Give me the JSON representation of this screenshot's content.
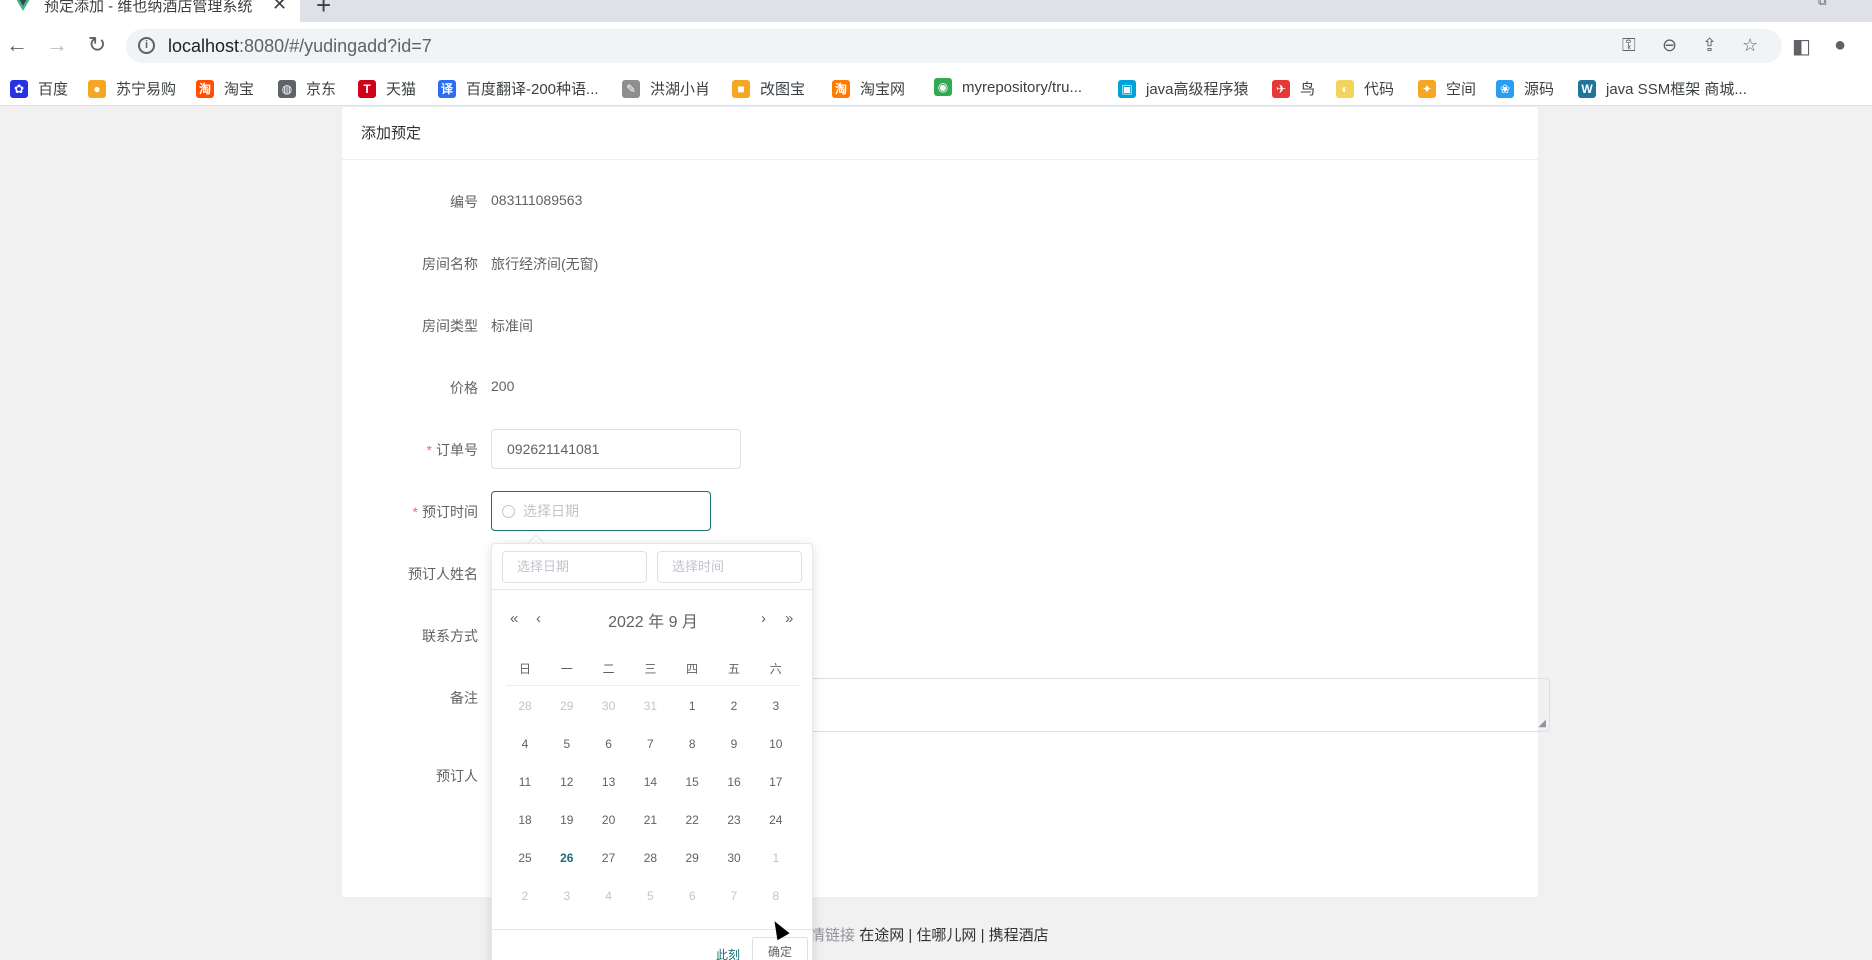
{
  "browser": {
    "tab_title": "预定添加 - 维也纳酒店管理系统",
    "tab_close": "✕",
    "new_tab": "+",
    "url_host": "localhost",
    "url_rest": ":8080/#/yudingadd?id=7"
  },
  "bookmarks": [
    {
      "label": "百度",
      "color": "#2932e1",
      "glyph": "✿"
    },
    {
      "label": "苏宁易购",
      "color": "#f5a623",
      "glyph": "●"
    },
    {
      "label": "淘宝",
      "color": "#ff5000",
      "glyph": "淘"
    },
    {
      "label": "京东",
      "color": "#5f6368",
      "glyph": "◍"
    },
    {
      "label": "天猫",
      "color": "#d0021b",
      "glyph": "T"
    },
    {
      "label": "百度翻译-200种语...",
      "color": "#2a6ef5",
      "glyph": "译"
    },
    {
      "label": "洪湖小肖",
      "color": "#8e8e8e",
      "glyph": "✎"
    },
    {
      "label": "改图宝",
      "color": "#f5a623",
      "glyph": "■"
    },
    {
      "label": "淘宝网",
      "color": "#ff7a00",
      "glyph": "淘"
    },
    {
      "label": "myrepository/tru...",
      "color": "#34a853",
      "glyph": "◉"
    },
    {
      "label": "java高级程序猿",
      "color": "#00a1d6",
      "glyph": "▣"
    },
    {
      "label": "鸟",
      "color": "#e53935",
      "glyph": "✈"
    },
    {
      "label": "代码",
      "color": "#f2d45c",
      "glyph": "◐"
    },
    {
      "label": "空间",
      "color": "#f5a623",
      "glyph": "✦"
    },
    {
      "label": "源码",
      "color": "#2a9df4",
      "glyph": "❀"
    },
    {
      "label": "java SSM框架 商城...",
      "color": "#21759b",
      "glyph": "W"
    }
  ],
  "card_title": "添加预定",
  "form": {
    "bianhao_label": "编号",
    "bianhao_value": "083111089563",
    "fangjianmingcheng_label": "房间名称",
    "fangjianmingcheng_value": "旅行经济间(无窗)",
    "fangjianleixing_label": "房间类型",
    "fangjianleixing_value": "标准间",
    "jiage_label": "价格",
    "jiage_value": "200",
    "dingdanhao_label": "订单号",
    "dingdanhao_value": "092621141081",
    "yudingshijian_label": "预订时间",
    "yudingshijian_placeholder": "选择日期",
    "yudingrenxingming_label": "预订人姓名",
    "lianxifangshi_label": "联系方式",
    "beizhu_label": "备注",
    "yudingren_label": "预订人",
    "required_mark": "*"
  },
  "picker": {
    "date_placeholder": "选择日期",
    "time_placeholder": "选择时间",
    "title": "2022 年  9 月",
    "weekdays": [
      "日",
      "一",
      "二",
      "三",
      "四",
      "五",
      "六"
    ],
    "weeks": [
      [
        {
          "d": "28",
          "m": true
        },
        {
          "d": "29",
          "m": true
        },
        {
          "d": "30",
          "m": true
        },
        {
          "d": "31",
          "m": true
        },
        {
          "d": "1"
        },
        {
          "d": "2"
        },
        {
          "d": "3"
        }
      ],
      [
        {
          "d": "4"
        },
        {
          "d": "5"
        },
        {
          "d": "6"
        },
        {
          "d": "7"
        },
        {
          "d": "8"
        },
        {
          "d": "9"
        },
        {
          "d": "10"
        }
      ],
      [
        {
          "d": "11"
        },
        {
          "d": "12"
        },
        {
          "d": "13"
        },
        {
          "d": "14"
        },
        {
          "d": "15"
        },
        {
          "d": "16"
        },
        {
          "d": "17"
        }
      ],
      [
        {
          "d": "18"
        },
        {
          "d": "19"
        },
        {
          "d": "20"
        },
        {
          "d": "21"
        },
        {
          "d": "22"
        },
        {
          "d": "23"
        },
        {
          "d": "24"
        }
      ],
      [
        {
          "d": "25"
        },
        {
          "d": "26",
          "today": true
        },
        {
          "d": "27"
        },
        {
          "d": "28"
        },
        {
          "d": "29"
        },
        {
          "d": "30"
        },
        {
          "d": "1",
          "m": true
        }
      ],
      [
        {
          "d": "2",
          "m": true
        },
        {
          "d": "3",
          "m": true
        },
        {
          "d": "4",
          "m": true
        },
        {
          "d": "5",
          "m": true
        },
        {
          "d": "6",
          "m": true
        },
        {
          "d": "7",
          "m": true
        },
        {
          "d": "8",
          "m": true
        }
      ]
    ],
    "now_label": "此刻",
    "confirm_label": "确定"
  },
  "footer": {
    "links_label": "友情链接",
    "links": "在途网 | 住哪儿网 | 携程酒店"
  },
  "colors": {
    "accent": "#1c6e74",
    "required": "#f56c6c"
  }
}
